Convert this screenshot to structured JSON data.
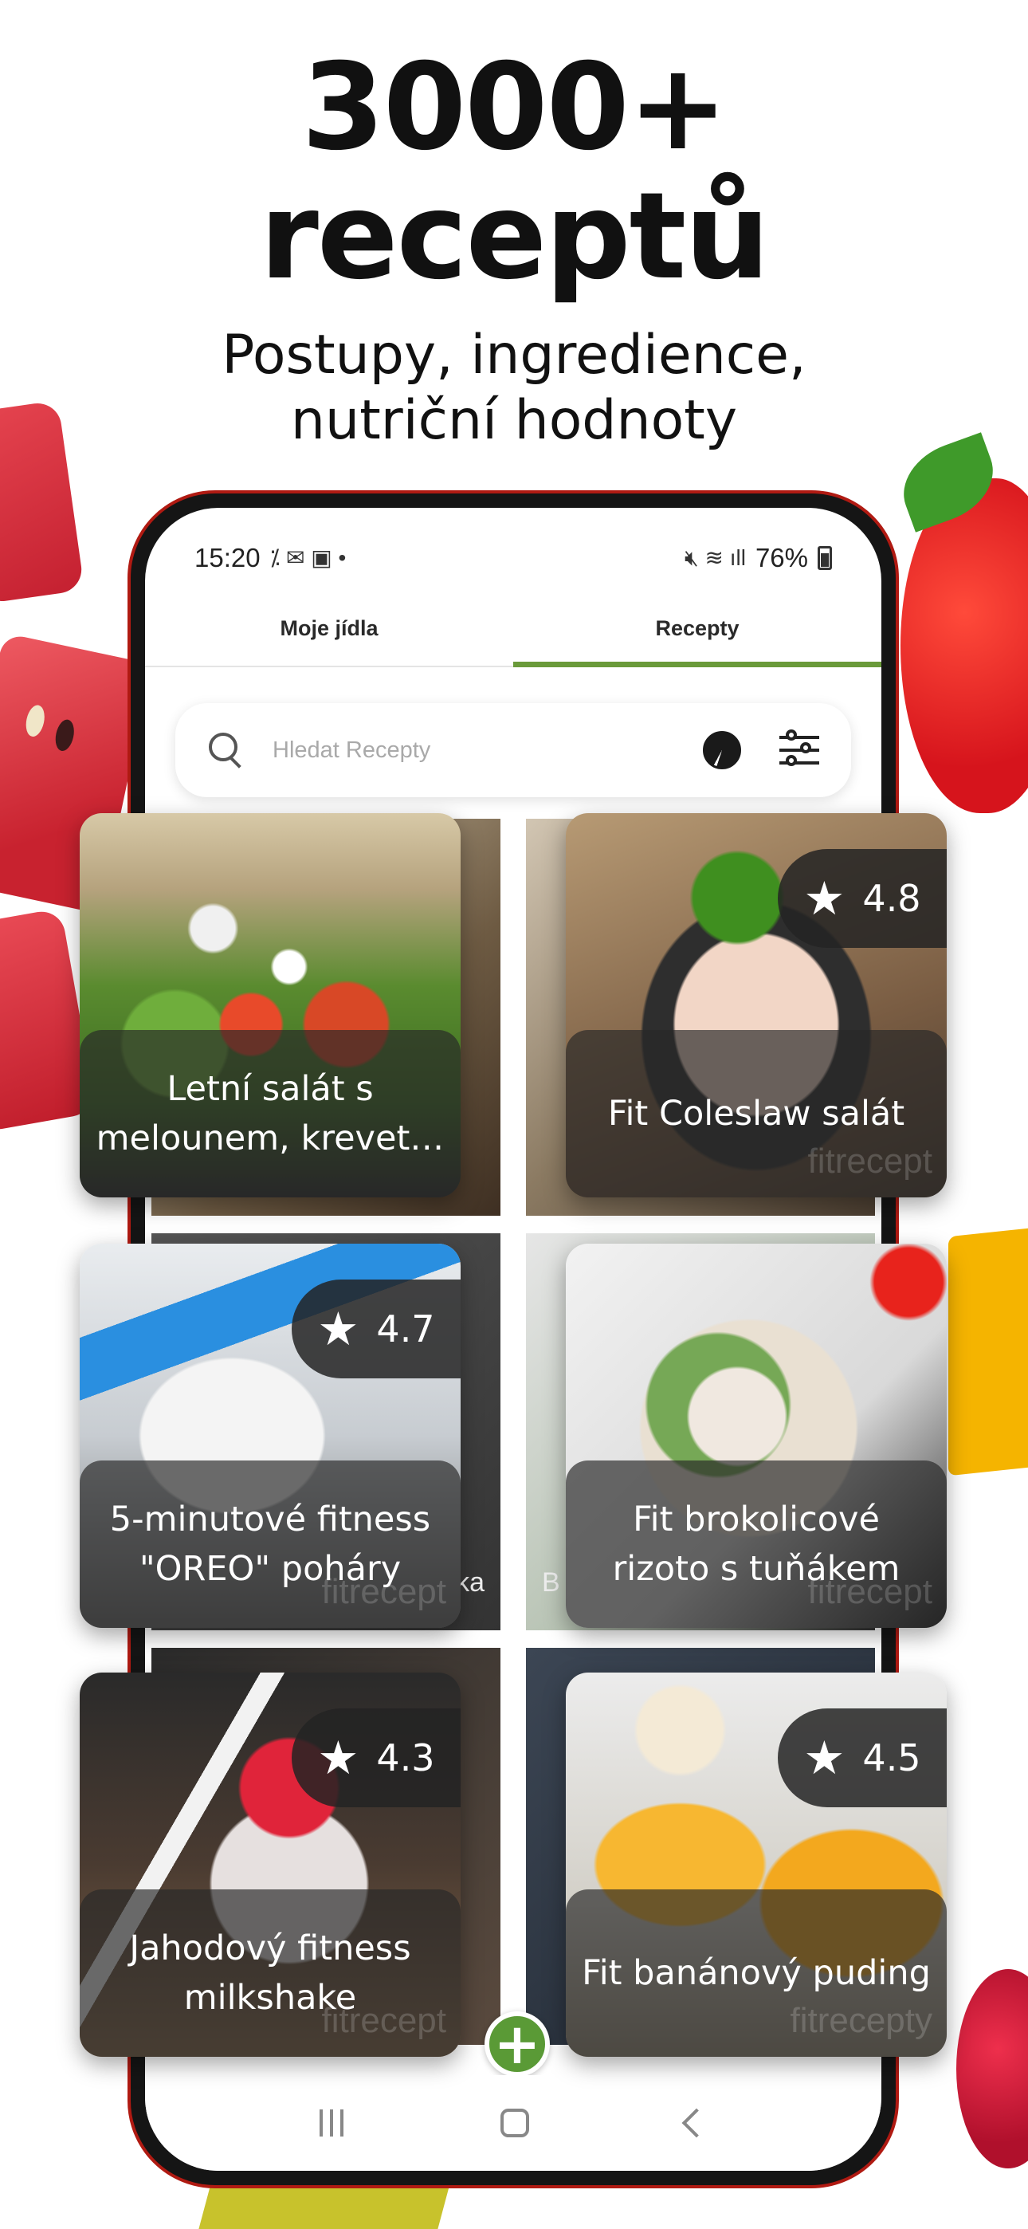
{
  "promo": {
    "headline_line1": "3000+",
    "headline_line2": "receptů",
    "subline_line1": "Postupy, ingredience,",
    "subline_line2": "nutriční hodnoty"
  },
  "statusbar": {
    "time": "15:20",
    "battery": "76%"
  },
  "tabs": [
    {
      "label": "Moje jídla",
      "active": false
    },
    {
      "label": "Recepty",
      "active": true
    }
  ],
  "search": {
    "placeholder": "Hledat Recepty"
  },
  "under_grid": {
    "peek_left": "ka",
    "peek_right": "B"
  },
  "recipes": [
    {
      "title": "Letní salát s melounem, krevet…",
      "rating": "",
      "watermark": ""
    },
    {
      "title": "Fit Coleslaw salát",
      "rating": "4.8",
      "watermark": "fitrecept"
    },
    {
      "title": "5-minutové fitness \"OREO\" poháry",
      "rating": "4.7",
      "watermark": "fitrecept"
    },
    {
      "title": "Fit brokolicové rizoto s tuňákem",
      "rating": "",
      "watermark": "fitrecept"
    },
    {
      "title": "Jahodový fitness milkshake",
      "rating": "4.3",
      "watermark": "fitrecept"
    },
    {
      "title": "Fit banánový puding",
      "rating": "4.5",
      "watermark": "fitrecepty"
    }
  ],
  "fab": {
    "label": "+"
  },
  "colors": {
    "accent_green": "#5a9a36",
    "tab_underline": "#6a9a3a",
    "phone_frame_red": "#b01a12"
  },
  "icons": [
    "search-icon",
    "nutrition-pie-icon",
    "filter-sliders-icon",
    "star-icon",
    "plus-icon",
    "nav-recent-icon",
    "nav-home-icon",
    "nav-back-icon"
  ]
}
